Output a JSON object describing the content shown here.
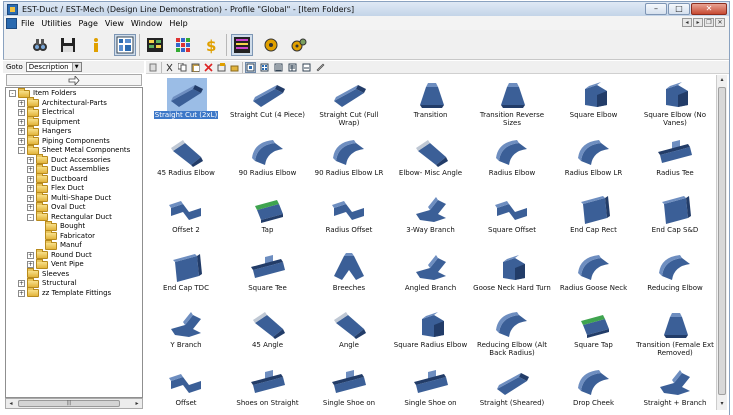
{
  "window": {
    "title": "EST-Duct / EST-Mech (Design Line Demonstration) - Profile \"Global\" - [Item Folders]"
  },
  "menu": {
    "items": [
      "File",
      "Utilities",
      "Page",
      "View",
      "Window",
      "Help"
    ]
  },
  "toolbar": {
    "icons": [
      "binoculars-icon",
      "save-icon",
      "info-icon",
      "grid-view-icon",
      "spreadsheet-icon",
      "color-grid-icon",
      "dollar-icon",
      "list-view-icon",
      "gear-icon",
      "gears-icon"
    ]
  },
  "left_panel": {
    "goto_label": "Goto",
    "goto_value": "Description"
  },
  "tree": [
    {
      "label": "Item Folders",
      "level": 0,
      "expander": "-"
    },
    {
      "label": "Architectural-Parts",
      "level": 1,
      "expander": "+"
    },
    {
      "label": "Electrical",
      "level": 1,
      "expander": "+"
    },
    {
      "label": "Equipment",
      "level": 1,
      "expander": "+"
    },
    {
      "label": "Hangers",
      "level": 1,
      "expander": "+"
    },
    {
      "label": "Piping Components",
      "level": 1,
      "expander": "+"
    },
    {
      "label": "Sheet Metal Components",
      "level": 1,
      "expander": "-"
    },
    {
      "label": "Duct Accessories",
      "level": 2,
      "expander": "+"
    },
    {
      "label": "Duct Assemblies",
      "level": 2,
      "expander": "+"
    },
    {
      "label": "Ductboard",
      "level": 2,
      "expander": "+"
    },
    {
      "label": "Flex Duct",
      "level": 2,
      "expander": "+"
    },
    {
      "label": "Multi-Shape Duct",
      "level": 2,
      "expander": "+"
    },
    {
      "label": "Oval Duct",
      "level": 2,
      "expander": "+"
    },
    {
      "label": "Rectangular Duct",
      "level": 2,
      "expander": "-"
    },
    {
      "label": "Bought",
      "level": 3,
      "expander": ""
    },
    {
      "label": "Fabricator",
      "level": 3,
      "expander": ""
    },
    {
      "label": "Manuf",
      "level": 3,
      "expander": ""
    },
    {
      "label": "Round Duct",
      "level": 2,
      "expander": "+"
    },
    {
      "label": "Vent Pipe",
      "level": 2,
      "expander": "+"
    },
    {
      "label": "Sleeves",
      "level": 1,
      "expander": ""
    },
    {
      "label": "Structural",
      "level": 1,
      "expander": "+"
    },
    {
      "label": "zz Template Fittings",
      "level": 1,
      "expander": "+"
    }
  ],
  "items": [
    {
      "label": "Straight Cut (2xL)",
      "shape": "straight",
      "selected": true
    },
    {
      "label": "Straight Cut (4 Piece)",
      "shape": "straight"
    },
    {
      "label": "Straight Cut (Full Wrap)",
      "shape": "straight"
    },
    {
      "label": "Transition",
      "shape": "transition"
    },
    {
      "label": "Transition Reverse Sizes",
      "shape": "transition"
    },
    {
      "label": "Square Elbow",
      "shape": "elbow"
    },
    {
      "label": "Square Elbow (No Vanes)",
      "shape": "elbow"
    },
    {
      "label": "45 Radius Elbow",
      "shape": "elbow45"
    },
    {
      "label": "90 Radius Elbow",
      "shape": "radius"
    },
    {
      "label": "90 Radius Elbow LR",
      "shape": "radius"
    },
    {
      "label": "Elbow- Misc Angle",
      "shape": "elbow45"
    },
    {
      "label": "Radius Elbow",
      "shape": "radius"
    },
    {
      "label": "Radius Elbow LR",
      "shape": "radius"
    },
    {
      "label": "Radius Tee",
      "shape": "tee"
    },
    {
      "label": "Offset 2",
      "shape": "offset"
    },
    {
      "label": "Tap",
      "shape": "tap"
    },
    {
      "label": "Radius Offset",
      "shape": "offset"
    },
    {
      "label": "3-Way Branch",
      "shape": "branch"
    },
    {
      "label": "Square Offset",
      "shape": "offset"
    },
    {
      "label": "End Cap Rect",
      "shape": "cap"
    },
    {
      "label": "End Cap S&D",
      "shape": "cap"
    },
    {
      "label": "End Cap TDC",
      "shape": "cap"
    },
    {
      "label": "Square Tee",
      "shape": "tee"
    },
    {
      "label": "Breeches",
      "shape": "breeches"
    },
    {
      "label": "Angled Branch",
      "shape": "branch"
    },
    {
      "label": "Goose Neck Hard Turn",
      "shape": "elbow"
    },
    {
      "label": "Radius Goose Neck",
      "shape": "radius"
    },
    {
      "label": "Reducing Elbow",
      "shape": "radius"
    },
    {
      "label": "Y Branch",
      "shape": "branch"
    },
    {
      "label": "45 Angle",
      "shape": "elbow45"
    },
    {
      "label": "Angle",
      "shape": "elbow45"
    },
    {
      "label": "Square Radius Elbow",
      "shape": "elbow"
    },
    {
      "label": "Reducing Elbow (Alt Back Radius)",
      "shape": "radius"
    },
    {
      "label": "Square Tap",
      "shape": "tap"
    },
    {
      "label": "Transition (Female Ext Removed)",
      "shape": "transition"
    },
    {
      "label": "Offset",
      "shape": "offset"
    },
    {
      "label": "Shoes on Straight",
      "shape": "tee"
    },
    {
      "label": "Single Shoe on",
      "shape": "tee"
    },
    {
      "label": "Single Shoe on",
      "shape": "tee"
    },
    {
      "label": "Straight (Sheared)",
      "shape": "straight"
    },
    {
      "label": "Drop Cheek",
      "shape": "radius"
    },
    {
      "label": "Straight + Branch",
      "shape": "branch"
    }
  ],
  "colors": {
    "duct_face": "#3b5f97",
    "duct_dark": "#223c68",
    "duct_light": "#6e8ec0",
    "selection": "#3d78c8",
    "selection_bg": "#9bbde6",
    "tap_green": "#3fa44f"
  }
}
